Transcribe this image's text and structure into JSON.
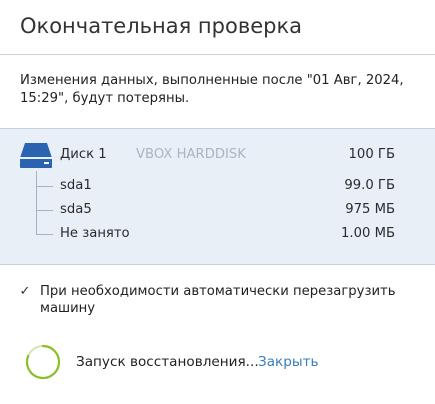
{
  "title": "Окончательная проверка",
  "warning": "Изменения данных, выполненные после \"01 Авг, 2024, 15:29\", будут потеряны.",
  "disk": {
    "name": "Диск 1",
    "model": "VBOX HARDDISK",
    "size": "100 ГБ",
    "partitions": [
      {
        "name": "sda1",
        "size": "99.0 ГБ"
      },
      {
        "name": "sda5",
        "size": "975 МБ"
      },
      {
        "name": "Не занято",
        "size": "1.00 МБ"
      }
    ]
  },
  "reboot_option": {
    "label": "При необходимости автоматически перезагрузить машину",
    "checked": true
  },
  "status": {
    "text": "Запуск восстановления...",
    "close_label": "Закрыть"
  },
  "colors": {
    "accent": "#2a63b0",
    "link": "#3a7dbd",
    "spinner": "#8bbf2a",
    "panel_bg": "#e9eff7"
  }
}
